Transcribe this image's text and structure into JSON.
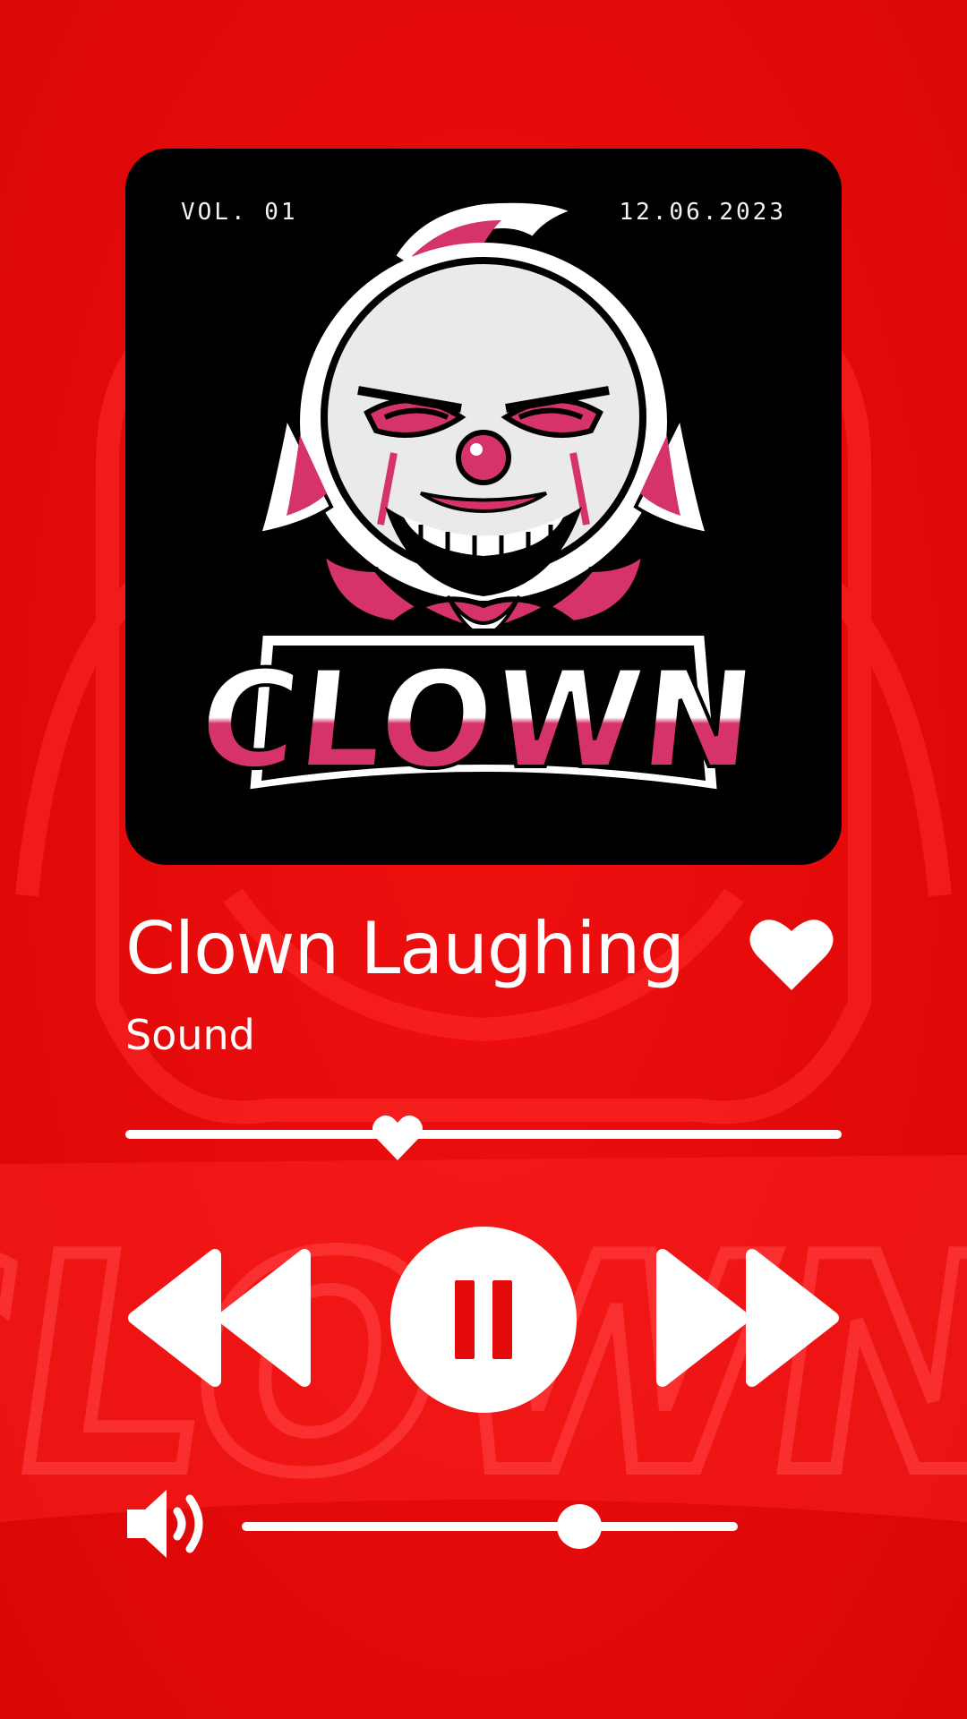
{
  "album_art": {
    "volume_label": "VOL. 01",
    "date_label": "12.06.2023",
    "logo_text": "CLOWN"
  },
  "track": {
    "title": "Clown Laughing",
    "subtitle": "Sound",
    "liked": true
  },
  "playback": {
    "progress_fraction": 0.38,
    "state": "playing"
  },
  "volume": {
    "level_fraction": 0.68
  },
  "icons": {
    "like": "heart-icon",
    "seek_thumb": "heart-icon",
    "rewind": "rewind-icon",
    "pause": "pause-icon",
    "forward": "fast-forward-icon",
    "volume": "speaker-icon"
  },
  "colors": {
    "background": "#e40a0a",
    "card": "#000000",
    "accent_pink": "#d6336c",
    "foreground": "#ffffff"
  }
}
